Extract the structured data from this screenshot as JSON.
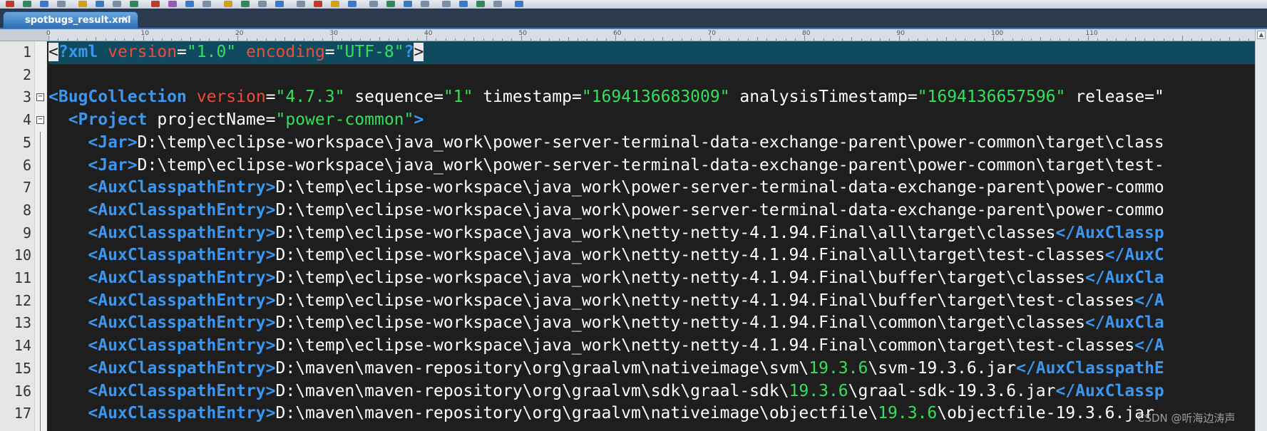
{
  "tab": {
    "title": "spotbugs_result.xml",
    "close": "×"
  },
  "ruler": {
    "labels": [
      "0",
      "10",
      "20",
      "30",
      "40",
      "50",
      "60",
      "70",
      "80",
      "90",
      "100",
      "110"
    ]
  },
  "gutter": {
    "line_numbers": [
      "1",
      "2",
      "3",
      "4",
      "5",
      "6",
      "7",
      "8",
      "9",
      "10",
      "11",
      "12",
      "13",
      "14",
      "15",
      "16",
      "17"
    ]
  },
  "code": {
    "lines": [
      [
        {
          "t": "<",
          "c": "bracket-match"
        },
        {
          "t": "?xml",
          "c": "xmlpi"
        },
        {
          "t": " ",
          "c": "txt"
        },
        {
          "t": "version",
          "c": "attr"
        },
        {
          "t": "=",
          "c": "txt"
        },
        {
          "t": "\"1.0\"",
          "c": "val"
        },
        {
          "t": " ",
          "c": "txt"
        },
        {
          "t": "encoding",
          "c": "attr"
        },
        {
          "t": "=",
          "c": "txt"
        },
        {
          "t": "\"UTF-8\"",
          "c": "val"
        },
        {
          "t": "?",
          "c": "xmlpi"
        },
        {
          "t": ">",
          "c": "bracket-match"
        }
      ],
      [],
      [
        {
          "t": "<BugCollection",
          "c": "tag"
        },
        {
          "t": " ",
          "c": "txt"
        },
        {
          "t": "version",
          "c": "attr"
        },
        {
          "t": "=",
          "c": "txt"
        },
        {
          "t": "\"4.7.3\"",
          "c": "val"
        },
        {
          "t": " sequence",
          "c": "attr2"
        },
        {
          "t": "=",
          "c": "txt"
        },
        {
          "t": "\"1\"",
          "c": "val"
        },
        {
          "t": " timestamp",
          "c": "attr2"
        },
        {
          "t": "=",
          "c": "txt"
        },
        {
          "t": "\"1694136683009\"",
          "c": "val"
        },
        {
          "t": " analysisTimestamp",
          "c": "attr2"
        },
        {
          "t": "=",
          "c": "txt"
        },
        {
          "t": "\"1694136657596\"",
          "c": "val"
        },
        {
          "t": " release",
          "c": "attr2"
        },
        {
          "t": "=\"",
          "c": "txt"
        }
      ],
      [
        {
          "t": "  ",
          "c": "txt"
        },
        {
          "t": "<Project",
          "c": "tag"
        },
        {
          "t": " projectName",
          "c": "attr2"
        },
        {
          "t": "=",
          "c": "txt"
        },
        {
          "t": "\"power-common\"",
          "c": "val"
        },
        {
          "t": ">",
          "c": "tag"
        }
      ],
      [
        {
          "t": "    ",
          "c": "txt"
        },
        {
          "t": "<Jar>",
          "c": "tag"
        },
        {
          "t": "D:\\temp\\eclipse-workspace\\java_work\\power-server-terminal-data-exchange-parent\\power-common\\target\\class",
          "c": "txt"
        }
      ],
      [
        {
          "t": "    ",
          "c": "txt"
        },
        {
          "t": "<Jar>",
          "c": "tag"
        },
        {
          "t": "D:\\temp\\eclipse-workspace\\java_work\\power-server-terminal-data-exchange-parent\\power-common\\target\\test-",
          "c": "txt"
        }
      ],
      [
        {
          "t": "    ",
          "c": "txt"
        },
        {
          "t": "<AuxClasspathEntry>",
          "c": "tag"
        },
        {
          "t": "D:\\temp\\eclipse-workspace\\java_work\\power-server-terminal-data-exchange-parent\\power-commo",
          "c": "txt"
        }
      ],
      [
        {
          "t": "    ",
          "c": "txt"
        },
        {
          "t": "<AuxClasspathEntry>",
          "c": "tag"
        },
        {
          "t": "D:\\temp\\eclipse-workspace\\java_work\\power-server-terminal-data-exchange-parent\\power-commo",
          "c": "txt"
        }
      ],
      [
        {
          "t": "    ",
          "c": "txt"
        },
        {
          "t": "<AuxClasspathEntry>",
          "c": "tag"
        },
        {
          "t": "D:\\temp\\eclipse-workspace\\java_work\\netty-netty-4.1.94.Final\\all\\target\\classes",
          "c": "txt"
        },
        {
          "t": "</AuxClassp",
          "c": "tag"
        }
      ],
      [
        {
          "t": "    ",
          "c": "txt"
        },
        {
          "t": "<AuxClasspathEntry>",
          "c": "tag"
        },
        {
          "t": "D:\\temp\\eclipse-workspace\\java_work\\netty-netty-4.1.94.Final\\all\\target\\test-classes",
          "c": "txt"
        },
        {
          "t": "</AuxC",
          "c": "tag"
        }
      ],
      [
        {
          "t": "    ",
          "c": "txt"
        },
        {
          "t": "<AuxClasspathEntry>",
          "c": "tag"
        },
        {
          "t": "D:\\temp\\eclipse-workspace\\java_work\\netty-netty-4.1.94.Final\\buffer\\target\\classes",
          "c": "txt"
        },
        {
          "t": "</AuxCla",
          "c": "tag"
        }
      ],
      [
        {
          "t": "    ",
          "c": "txt"
        },
        {
          "t": "<AuxClasspathEntry>",
          "c": "tag"
        },
        {
          "t": "D:\\temp\\eclipse-workspace\\java_work\\netty-netty-4.1.94.Final\\buffer\\target\\test-classes",
          "c": "txt"
        },
        {
          "t": "</A",
          "c": "tag"
        }
      ],
      [
        {
          "t": "    ",
          "c": "txt"
        },
        {
          "t": "<AuxClasspathEntry>",
          "c": "tag"
        },
        {
          "t": "D:\\temp\\eclipse-workspace\\java_work\\netty-netty-4.1.94.Final\\common\\target\\classes",
          "c": "txt"
        },
        {
          "t": "</AuxCla",
          "c": "tag"
        }
      ],
      [
        {
          "t": "    ",
          "c": "txt"
        },
        {
          "t": "<AuxClasspathEntry>",
          "c": "tag"
        },
        {
          "t": "D:\\temp\\eclipse-workspace\\java_work\\netty-netty-4.1.94.Final\\common\\target\\test-classes",
          "c": "txt"
        },
        {
          "t": "</A",
          "c": "tag"
        }
      ],
      [
        {
          "t": "    ",
          "c": "txt"
        },
        {
          "t": "<AuxClasspathEntry>",
          "c": "tag"
        },
        {
          "t": "D:\\maven\\maven-repository\\org\\graalvm\\nativeimage\\svm\\",
          "c": "txt"
        },
        {
          "t": "19.3.6",
          "c": "val"
        },
        {
          "t": "\\svm-19.3.6.jar",
          "c": "txt"
        },
        {
          "t": "</AuxClasspathE",
          "c": "tag"
        }
      ],
      [
        {
          "t": "    ",
          "c": "txt"
        },
        {
          "t": "<AuxClasspathEntry>",
          "c": "tag"
        },
        {
          "t": "D:\\maven\\maven-repository\\org\\graalvm\\sdk\\graal-sdk\\",
          "c": "txt"
        },
        {
          "t": "19.3.6",
          "c": "val"
        },
        {
          "t": "\\graal-sdk-19.3.6.jar",
          "c": "txt"
        },
        {
          "t": "</AuxClassp",
          "c": "tag"
        }
      ],
      [
        {
          "t": "    ",
          "c": "txt"
        },
        {
          "t": "<AuxClasspathEntry>",
          "c": "tag"
        },
        {
          "t": "D:\\maven\\maven-repository\\org\\graalvm\\nativeimage\\objectfile\\",
          "c": "txt"
        },
        {
          "t": "19.3.6",
          "c": "val"
        },
        {
          "t": "\\objectfile-19.3.6.jar",
          "c": "txt"
        }
      ]
    ]
  },
  "watermark": "CSDN @听海边涛声"
}
